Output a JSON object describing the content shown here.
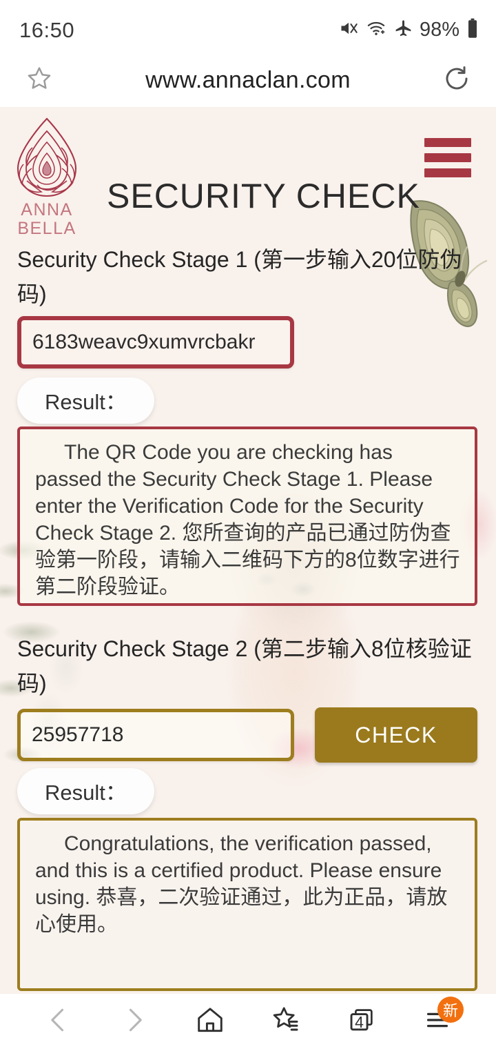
{
  "status_bar": {
    "time": "16:50",
    "battery": "98%",
    "icons": [
      "mute-icon",
      "wifi-icon",
      "airplane-mode-icon",
      "battery-icon"
    ]
  },
  "browser": {
    "url": "www.annaclan.com",
    "bookmark_icon": "star-icon",
    "reload_icon": "reload-icon"
  },
  "header": {
    "brand_line1": "ANNA",
    "brand_line2": "BELLA",
    "title": "SECURITY CHECK",
    "menu_icon": "hamburger-menu-icon"
  },
  "stage1": {
    "label": "Security Check Stage 1 (第一步输入20位防伪码)",
    "input_value": "6183weavc9xumvrcbakr",
    "input_placeholder": "",
    "result_label": "Result：",
    "result_text": "The QR Code you are checking has passed the Security Check Stage 1. Please enter the Verification Code for the Security Check Stage 2. 您所查询的产品已通过防伪查验第一阶段，请输入二维码下方的8位数字进行第二阶段验证。"
  },
  "stage2": {
    "label": "Security Check Stage 2 (第二步输入8位核验证码)",
    "input_value": "25957718",
    "input_placeholder": "",
    "check_button": "CHECK",
    "result_label": "Result：",
    "result_text": "Congratulations, the verification passed, and this is a certified product. Please ensure using. 恭喜，二次验证通过，此为正品，请放心使用。"
  },
  "bottom_nav": {
    "back_icon": "chevron-left-icon",
    "forward_icon": "chevron-right-icon",
    "home_icon": "home-icon",
    "bookmarks_icon": "bookmarks-star-icon",
    "tabs_icon": "tabs-icon",
    "tabs_count": "4",
    "menu_icon": "menu-icon",
    "menu_badge": "新"
  },
  "colors": {
    "page_background": "#f9f1ec",
    "brand_red": "#a73843",
    "brand_gold": "#9a7a1d",
    "logo_pink": "#c4767f",
    "badge_orange": "#f2700f"
  }
}
